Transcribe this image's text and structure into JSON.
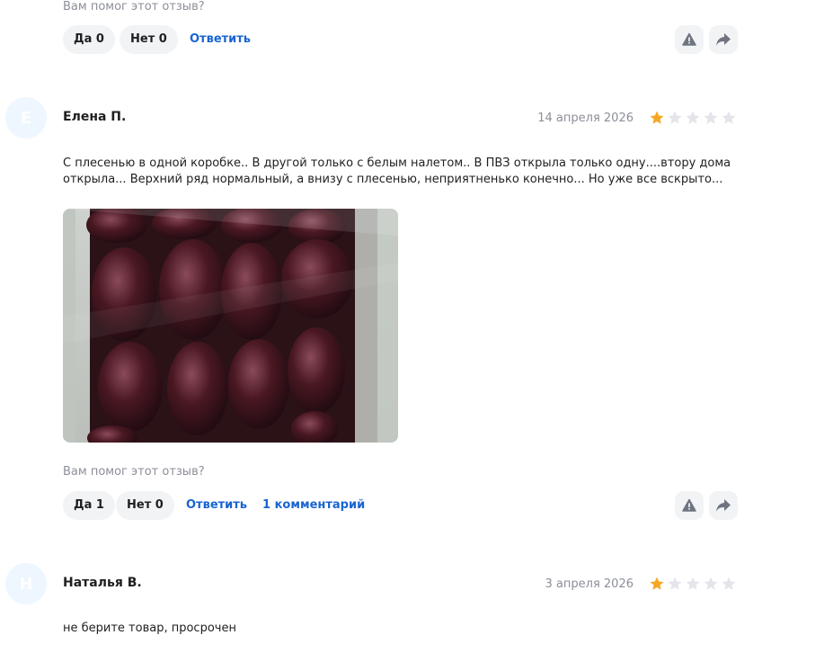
{
  "top": {
    "helpful_question": "Вам помог этот отзыв?",
    "yes_label": "Да 0",
    "no_label": "Нет 0",
    "reply_label": "Ответить"
  },
  "reviews": [
    {
      "avatar_letter": "Е",
      "author": "Елена П.",
      "date": "14 апреля 2026",
      "rating": 1,
      "text": "С плесенью в одной коробке.. В другой только с белым налетом.. В ПВЗ открыла только одну....втору дома открыла... Верхний ряд нормальный, а внизу с плесенью, неприятненько конечно... Но уже все вскрыто...",
      "helpful_question": "Вам помог этот отзыв?",
      "yes_label": "Да 1",
      "no_label": "Нет 0",
      "reply_label": "Ответить",
      "comments_label": "1 комментарий"
    },
    {
      "avatar_letter": "Н",
      "author": "Наталья В.",
      "date": "3 апреля 2026",
      "rating": 1,
      "text": "не берите товар, просрочен"
    }
  ],
  "colors": {
    "star_filled": "#f5a623",
    "star_empty": "#e3e5ea",
    "link": "#1a64d2",
    "muted": "#8c8f99"
  },
  "icons": {
    "report": "warning-triangle-icon",
    "share": "share-arrow-icon"
  }
}
